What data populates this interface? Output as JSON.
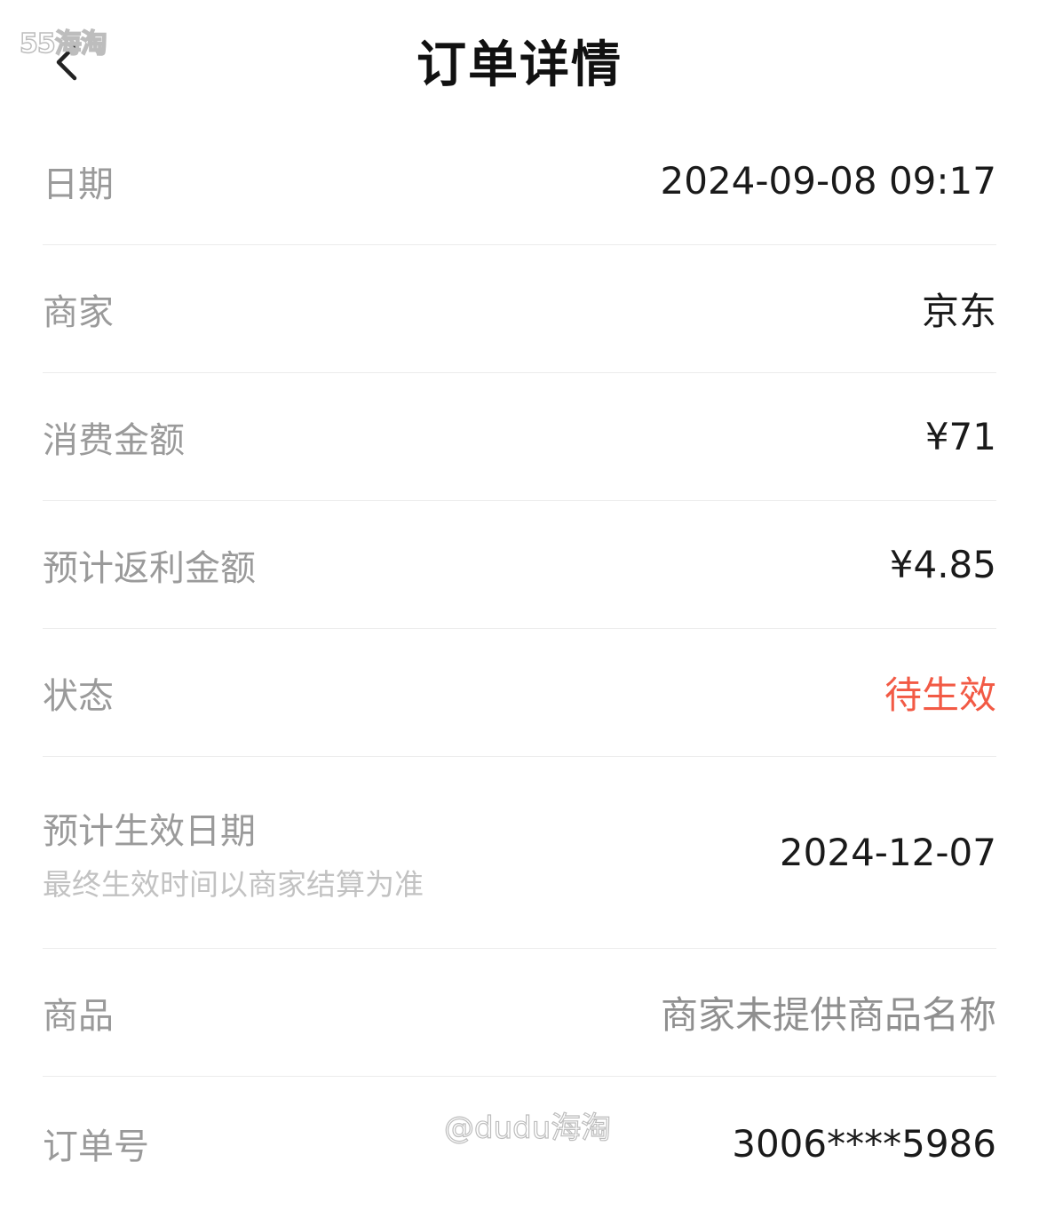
{
  "watermark_top": "55海淘",
  "header": {
    "title": "订单详情"
  },
  "rows": [
    {
      "label": "日期",
      "value": "2024-09-08 09:17"
    },
    {
      "label": "商家",
      "value": "京东"
    },
    {
      "label": "消费金额",
      "value": "¥71"
    },
    {
      "label": "预计返利金额",
      "value": "¥4.85"
    },
    {
      "label": "状态",
      "value": "待生效"
    },
    {
      "label": "预计生效日期",
      "sublabel": "最终生效时间以商家结算为准",
      "value": "2024-12-07"
    },
    {
      "label": "商品",
      "value": "商家未提供商品名称"
    },
    {
      "label": "订单号",
      "value": "3006****5986"
    }
  ],
  "colors": {
    "status": "#f25a45",
    "label": "#9a9a9a",
    "value": "#1a1a1a"
  },
  "watermark_bottom": "@dudu海淘",
  "icons": {
    "back": "chevron-left-icon"
  }
}
